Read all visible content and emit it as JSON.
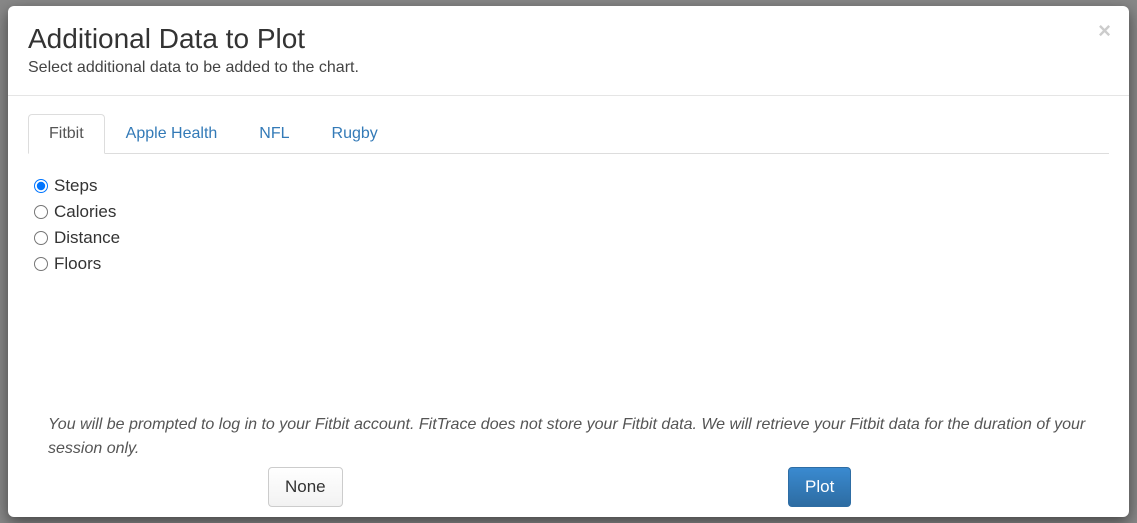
{
  "modal": {
    "title": "Additional Data to Plot",
    "subtitle": "Select additional data to be added to the chart.",
    "close_glyph": "×"
  },
  "tabs": [
    {
      "label": "Fitbit",
      "active": true
    },
    {
      "label": "Apple Health",
      "active": false
    },
    {
      "label": "NFL",
      "active": false
    },
    {
      "label": "Rugby",
      "active": false
    }
  ],
  "options": [
    {
      "label": "Steps",
      "checked": true
    },
    {
      "label": "Calories",
      "checked": false
    },
    {
      "label": "Distance",
      "checked": false
    },
    {
      "label": "Floors",
      "checked": false
    }
  ],
  "notice": "You will be prompted to log in to your Fitbit account. FitTrace does not store your Fitbit data. We will retrieve your Fitbit data for the duration of your session only.",
  "buttons": {
    "none": "None",
    "plot": "Plot"
  }
}
